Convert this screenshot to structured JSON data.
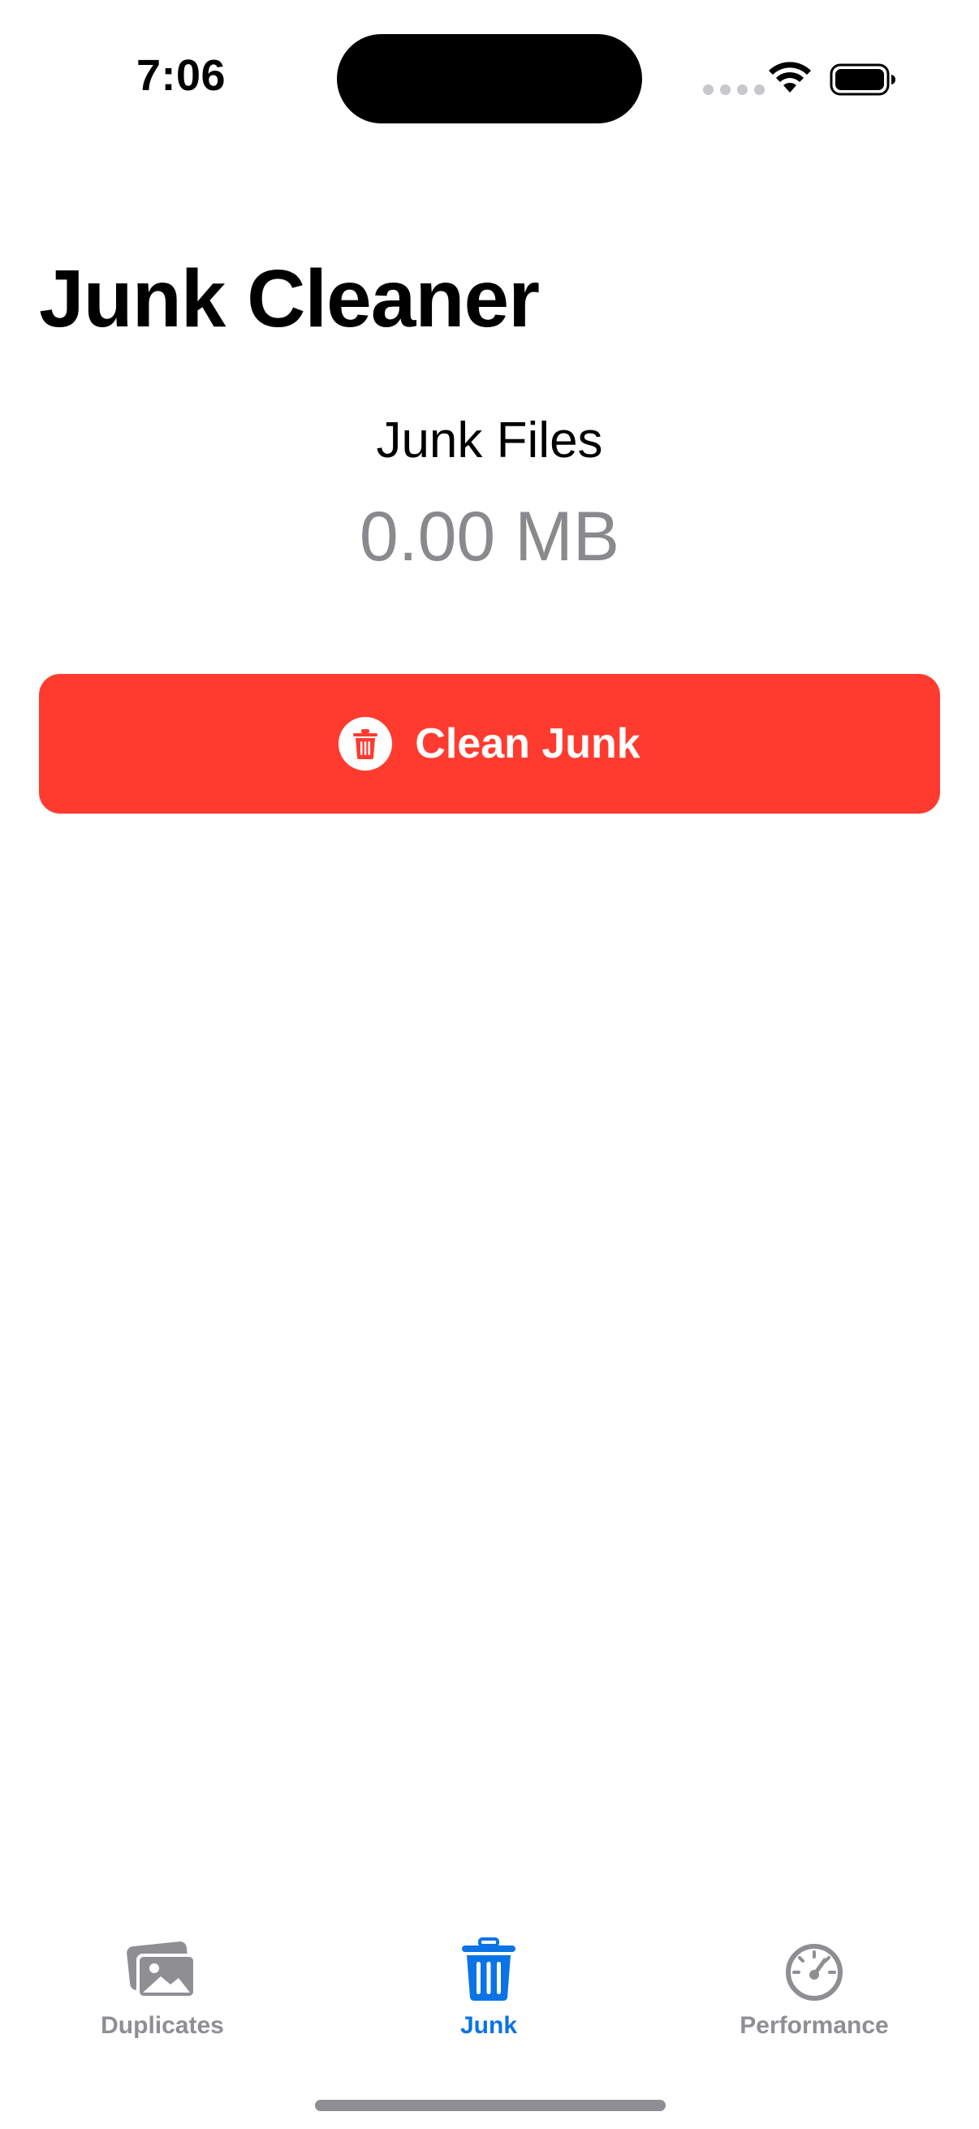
{
  "status_bar": {
    "time": "7:06"
  },
  "page": {
    "title": "Junk Cleaner"
  },
  "summary": {
    "label": "Junk Files",
    "value": "0.00 MB"
  },
  "clean_button": {
    "label": "Clean Junk",
    "icon": "trash-icon",
    "color": "#ff3b30"
  },
  "tab_bar": {
    "active_tab": "Junk",
    "active_color": "#0a73e6",
    "inactive_color": "#8e8e93",
    "tabs": [
      {
        "label": "Duplicates",
        "icon": "photos-icon"
      },
      {
        "label": "Junk",
        "icon": "trash-icon"
      },
      {
        "label": "Performance",
        "icon": "speedometer-icon"
      }
    ]
  }
}
